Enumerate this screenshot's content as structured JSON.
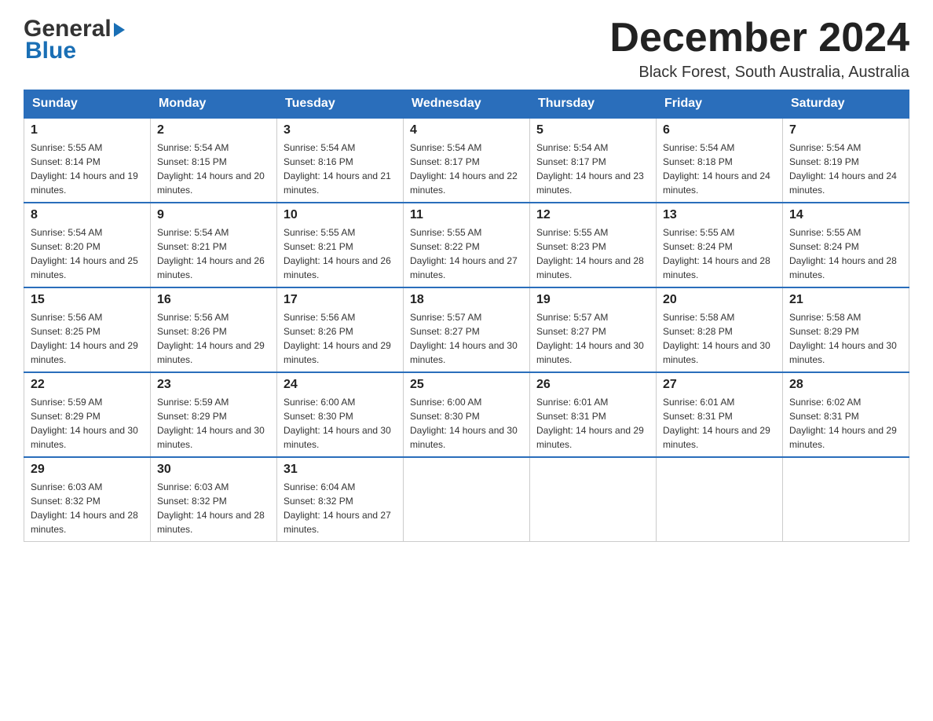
{
  "header": {
    "logo_general": "General",
    "logo_blue": "Blue",
    "month_title": "December 2024",
    "location": "Black Forest, South Australia, Australia"
  },
  "columns": [
    "Sunday",
    "Monday",
    "Tuesday",
    "Wednesday",
    "Thursday",
    "Friday",
    "Saturday"
  ],
  "weeks": [
    [
      {
        "day": "1",
        "sunrise": "Sunrise: 5:55 AM",
        "sunset": "Sunset: 8:14 PM",
        "daylight": "Daylight: 14 hours and 19 minutes."
      },
      {
        "day": "2",
        "sunrise": "Sunrise: 5:54 AM",
        "sunset": "Sunset: 8:15 PM",
        "daylight": "Daylight: 14 hours and 20 minutes."
      },
      {
        "day": "3",
        "sunrise": "Sunrise: 5:54 AM",
        "sunset": "Sunset: 8:16 PM",
        "daylight": "Daylight: 14 hours and 21 minutes."
      },
      {
        "day": "4",
        "sunrise": "Sunrise: 5:54 AM",
        "sunset": "Sunset: 8:17 PM",
        "daylight": "Daylight: 14 hours and 22 minutes."
      },
      {
        "day": "5",
        "sunrise": "Sunrise: 5:54 AM",
        "sunset": "Sunset: 8:17 PM",
        "daylight": "Daylight: 14 hours and 23 minutes."
      },
      {
        "day": "6",
        "sunrise": "Sunrise: 5:54 AM",
        "sunset": "Sunset: 8:18 PM",
        "daylight": "Daylight: 14 hours and 24 minutes."
      },
      {
        "day": "7",
        "sunrise": "Sunrise: 5:54 AM",
        "sunset": "Sunset: 8:19 PM",
        "daylight": "Daylight: 14 hours and 24 minutes."
      }
    ],
    [
      {
        "day": "8",
        "sunrise": "Sunrise: 5:54 AM",
        "sunset": "Sunset: 8:20 PM",
        "daylight": "Daylight: 14 hours and 25 minutes."
      },
      {
        "day": "9",
        "sunrise": "Sunrise: 5:54 AM",
        "sunset": "Sunset: 8:21 PM",
        "daylight": "Daylight: 14 hours and 26 minutes."
      },
      {
        "day": "10",
        "sunrise": "Sunrise: 5:55 AM",
        "sunset": "Sunset: 8:21 PM",
        "daylight": "Daylight: 14 hours and 26 minutes."
      },
      {
        "day": "11",
        "sunrise": "Sunrise: 5:55 AM",
        "sunset": "Sunset: 8:22 PM",
        "daylight": "Daylight: 14 hours and 27 minutes."
      },
      {
        "day": "12",
        "sunrise": "Sunrise: 5:55 AM",
        "sunset": "Sunset: 8:23 PM",
        "daylight": "Daylight: 14 hours and 28 minutes."
      },
      {
        "day": "13",
        "sunrise": "Sunrise: 5:55 AM",
        "sunset": "Sunset: 8:24 PM",
        "daylight": "Daylight: 14 hours and 28 minutes."
      },
      {
        "day": "14",
        "sunrise": "Sunrise: 5:55 AM",
        "sunset": "Sunset: 8:24 PM",
        "daylight": "Daylight: 14 hours and 28 minutes."
      }
    ],
    [
      {
        "day": "15",
        "sunrise": "Sunrise: 5:56 AM",
        "sunset": "Sunset: 8:25 PM",
        "daylight": "Daylight: 14 hours and 29 minutes."
      },
      {
        "day": "16",
        "sunrise": "Sunrise: 5:56 AM",
        "sunset": "Sunset: 8:26 PM",
        "daylight": "Daylight: 14 hours and 29 minutes."
      },
      {
        "day": "17",
        "sunrise": "Sunrise: 5:56 AM",
        "sunset": "Sunset: 8:26 PM",
        "daylight": "Daylight: 14 hours and 29 minutes."
      },
      {
        "day": "18",
        "sunrise": "Sunrise: 5:57 AM",
        "sunset": "Sunset: 8:27 PM",
        "daylight": "Daylight: 14 hours and 30 minutes."
      },
      {
        "day": "19",
        "sunrise": "Sunrise: 5:57 AM",
        "sunset": "Sunset: 8:27 PM",
        "daylight": "Daylight: 14 hours and 30 minutes."
      },
      {
        "day": "20",
        "sunrise": "Sunrise: 5:58 AM",
        "sunset": "Sunset: 8:28 PM",
        "daylight": "Daylight: 14 hours and 30 minutes."
      },
      {
        "day": "21",
        "sunrise": "Sunrise: 5:58 AM",
        "sunset": "Sunset: 8:29 PM",
        "daylight": "Daylight: 14 hours and 30 minutes."
      }
    ],
    [
      {
        "day": "22",
        "sunrise": "Sunrise: 5:59 AM",
        "sunset": "Sunset: 8:29 PM",
        "daylight": "Daylight: 14 hours and 30 minutes."
      },
      {
        "day": "23",
        "sunrise": "Sunrise: 5:59 AM",
        "sunset": "Sunset: 8:29 PM",
        "daylight": "Daylight: 14 hours and 30 minutes."
      },
      {
        "day": "24",
        "sunrise": "Sunrise: 6:00 AM",
        "sunset": "Sunset: 8:30 PM",
        "daylight": "Daylight: 14 hours and 30 minutes."
      },
      {
        "day": "25",
        "sunrise": "Sunrise: 6:00 AM",
        "sunset": "Sunset: 8:30 PM",
        "daylight": "Daylight: 14 hours and 30 minutes."
      },
      {
        "day": "26",
        "sunrise": "Sunrise: 6:01 AM",
        "sunset": "Sunset: 8:31 PM",
        "daylight": "Daylight: 14 hours and 29 minutes."
      },
      {
        "day": "27",
        "sunrise": "Sunrise: 6:01 AM",
        "sunset": "Sunset: 8:31 PM",
        "daylight": "Daylight: 14 hours and 29 minutes."
      },
      {
        "day": "28",
        "sunrise": "Sunrise: 6:02 AM",
        "sunset": "Sunset: 8:31 PM",
        "daylight": "Daylight: 14 hours and 29 minutes."
      }
    ],
    [
      {
        "day": "29",
        "sunrise": "Sunrise: 6:03 AM",
        "sunset": "Sunset: 8:32 PM",
        "daylight": "Daylight: 14 hours and 28 minutes."
      },
      {
        "day": "30",
        "sunrise": "Sunrise: 6:03 AM",
        "sunset": "Sunset: 8:32 PM",
        "daylight": "Daylight: 14 hours and 28 minutes."
      },
      {
        "day": "31",
        "sunrise": "Sunrise: 6:04 AM",
        "sunset": "Sunset: 8:32 PM",
        "daylight": "Daylight: 14 hours and 27 minutes."
      },
      null,
      null,
      null,
      null
    ]
  ]
}
